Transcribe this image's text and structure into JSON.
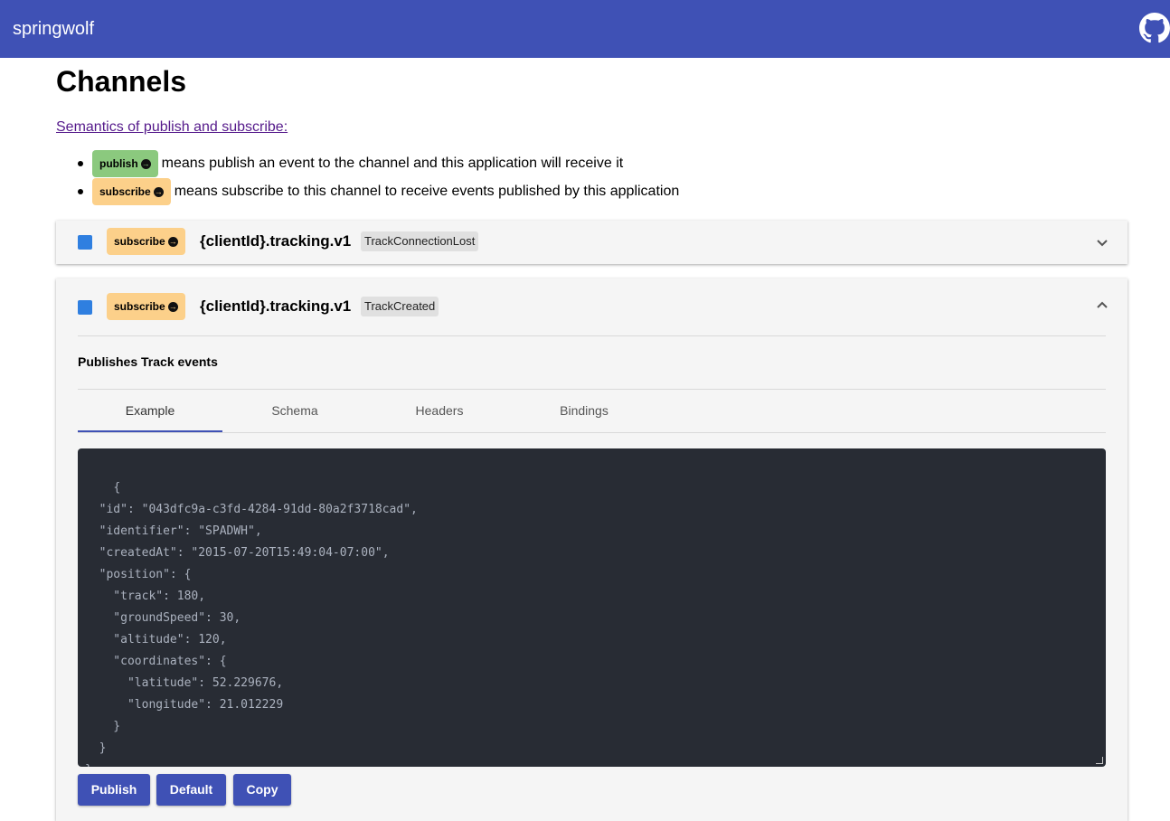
{
  "header": {
    "brand": "springwolf",
    "github_icon": "github-icon"
  },
  "page": {
    "title": "Channels",
    "semantics_link": "Semantics of publish and subscribe:",
    "legend": [
      {
        "tag": "publish",
        "text": "means publish an event to the channel and this application will receive it"
      },
      {
        "tag": "subscribe",
        "text": "means subscribe to this channel to receive events published by this application"
      }
    ]
  },
  "colors": {
    "accent": "#3f51b5",
    "publish": "#8bc97e",
    "subscribe": "#fcd08a",
    "checkbox": "#2f7fe0",
    "code_bg": "#282c34"
  },
  "channels": [
    {
      "operation": "subscribe",
      "name": "{clientId}.tracking.v1",
      "message": "TrackConnectionLost",
      "expanded": false,
      "chevron": "expand-more-icon"
    },
    {
      "operation": "subscribe",
      "name": "{clientId}.tracking.v1",
      "message": "TrackCreated",
      "expanded": true,
      "chevron": "expand-less-icon",
      "description": "Publishes Track events",
      "tabs": [
        "Example",
        "Schema",
        "Headers",
        "Bindings"
      ],
      "active_tab": "Example",
      "example": "{\n  \"id\": \"043dfc9a-c3fd-4284-91dd-80a2f3718cad\",\n  \"identifier\": \"SPADWH\",\n  \"createdAt\": \"2015-07-20T15:49:04-07:00\",\n  \"position\": {\n    \"track\": 180,\n    \"groundSpeed\": 30,\n    \"altitude\": 120,\n    \"coordinates\": {\n      \"latitude\": 52.229676,\n      \"longitude\": 21.012229\n    }\n  }\n}",
      "buttons": [
        "Publish",
        "Default",
        "Copy"
      ]
    }
  ]
}
